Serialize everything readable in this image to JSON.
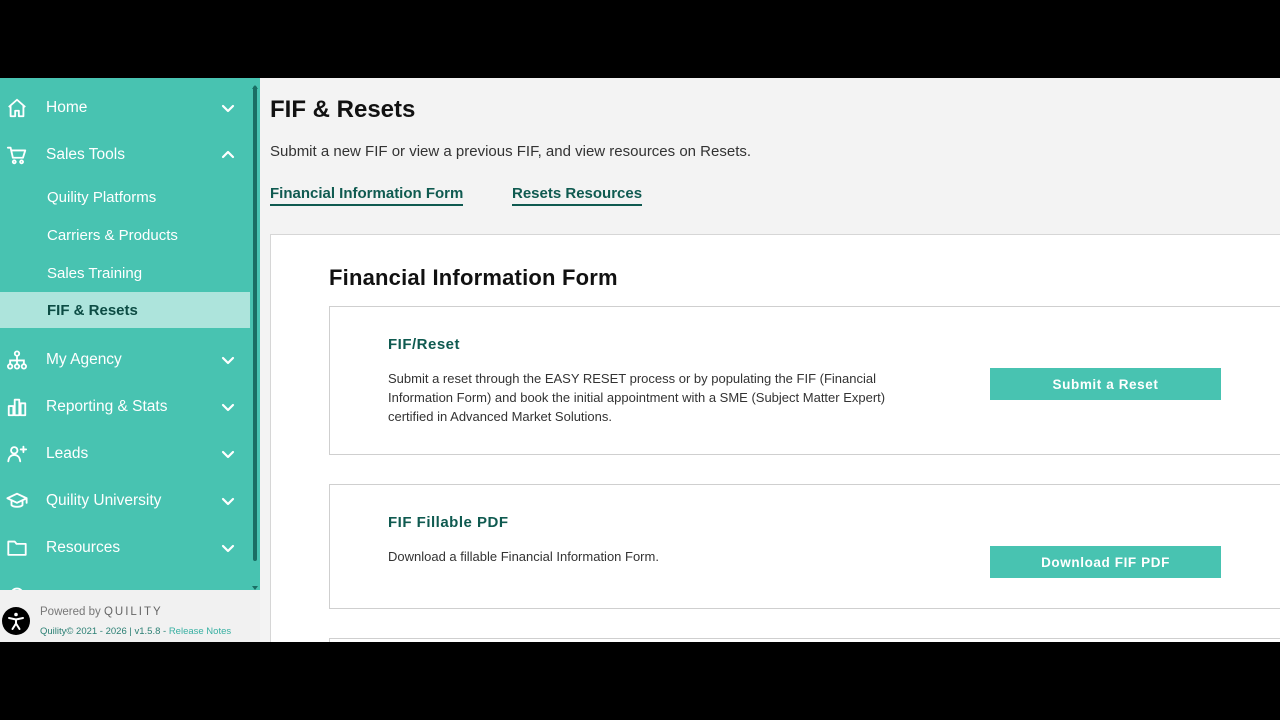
{
  "colors": {
    "accent": "#48c3b1",
    "accent_light": "#ade4dc",
    "link_dark": "#0f5a50"
  },
  "sidebar": {
    "items": [
      {
        "label": "Home",
        "icon": "home-icon",
        "chevron": "chevron-down-icon"
      },
      {
        "label": "Sales Tools",
        "icon": "cart-icon",
        "chevron": "chevron-up-icon",
        "expanded": true
      },
      {
        "label": "My Agency",
        "icon": "org-chart-icon",
        "chevron": "chevron-down-icon"
      },
      {
        "label": "Reporting & Stats",
        "icon": "bar-chart-icon",
        "chevron": "chevron-down-icon"
      },
      {
        "label": "Leads",
        "icon": "leads-icon",
        "chevron": "chevron-down-icon"
      },
      {
        "label": "Quility University",
        "icon": "graduation-cap-icon",
        "chevron": "chevron-down-icon"
      },
      {
        "label": "Resources",
        "icon": "folder-icon",
        "chevron": "chevron-down-icon"
      }
    ],
    "subitems": [
      {
        "label": "Quility Platforms"
      },
      {
        "label": "Carriers & Products"
      },
      {
        "label": "Sales Training"
      },
      {
        "label": "FIF & Resets",
        "active": true
      }
    ],
    "footer": {
      "powered_prefix": "Powered by",
      "powered_brand": "QUILITY",
      "copyright": "Quility© 2021 - 2026 | v1.5.8 - ",
      "release_notes": "Release Notes"
    }
  },
  "main": {
    "title": "FIF & Resets",
    "subtitle": "Submit a new FIF or view a previous FIF, and view resources on Resets.",
    "tabs": [
      {
        "label": "Financial Information Form"
      },
      {
        "label": "Resets Resources"
      }
    ],
    "card": {
      "title": "Financial Information Form",
      "blocks": [
        {
          "heading": "FIF/Reset",
          "text": "Submit a reset through the EASY RESET process or by populating the FIF (Financial Information Form) and book the initial appointment with a SME (Subject Matter Expert) certified in Advanced Market Solutions.",
          "button": "Submit a Reset"
        },
        {
          "heading": "FIF Fillable PDF",
          "text": "Download a fillable Financial Information Form.",
          "button": "Download FIF PDF"
        }
      ]
    }
  }
}
